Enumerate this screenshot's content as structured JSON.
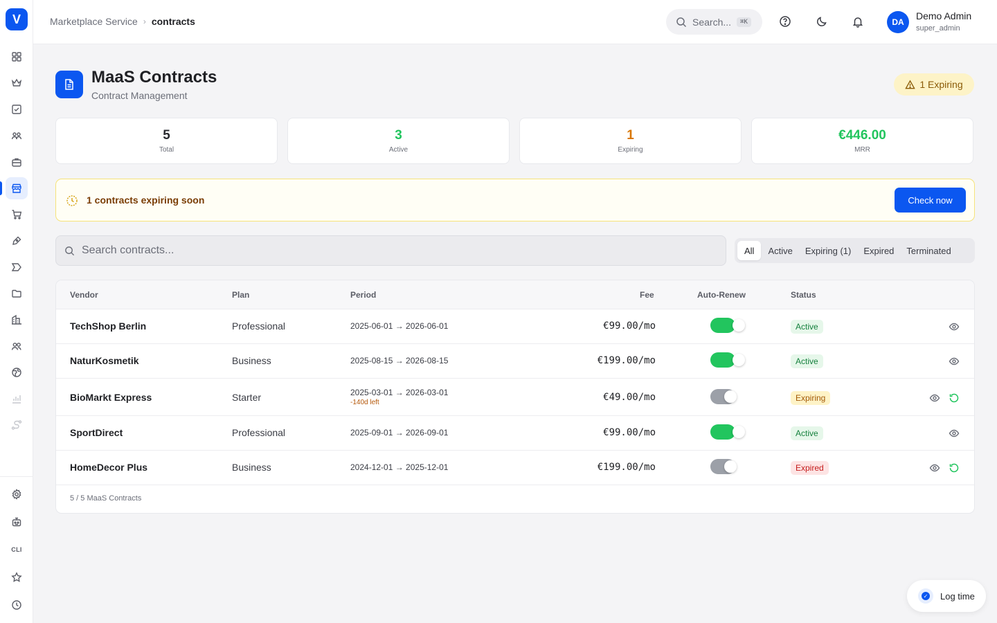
{
  "app": {
    "logo_letter": "V"
  },
  "breadcrumb": {
    "parent": "Marketplace Service",
    "separator": "›",
    "current": "contracts"
  },
  "topbar": {
    "search_placeholder": "Search...",
    "shortcut": "⌘K",
    "user": {
      "initials": "DA",
      "name": "Demo Admin",
      "role": "super_admin"
    }
  },
  "header": {
    "title": "MaaS Contracts",
    "subtitle": "Contract Management",
    "expiring_badge": "1 Expiring"
  },
  "stats": [
    {
      "value": "5",
      "label": "Total",
      "color": "#2a2b30"
    },
    {
      "value": "3",
      "label": "Active",
      "color": "#22c55e"
    },
    {
      "value": "1",
      "label": "Expiring",
      "color": "#d97706"
    },
    {
      "value": "€446.00",
      "label": "MRR",
      "color": "#22c55e"
    }
  ],
  "alert": {
    "text": "1 contracts expiring soon",
    "button": "Check now"
  },
  "search": {
    "placeholder": "Search contracts..."
  },
  "filters": [
    "All",
    "Active",
    "Expiring (1)",
    "Expired",
    "Terminated"
  ],
  "table": {
    "headers": {
      "vendor": "Vendor",
      "plan": "Plan",
      "period": "Period",
      "fee": "Fee",
      "auto_renew": "Auto-Renew",
      "status": "Status"
    },
    "rows": [
      {
        "vendor": "TechShop Berlin",
        "plan": "Professional",
        "period": "2025-06-01 → 2026-06-01",
        "days_left": "",
        "fee": "€99.00/mo",
        "auto_renew": true,
        "status": "Active",
        "renewable": false
      },
      {
        "vendor": "NaturKosmetik",
        "plan": "Business",
        "period": "2025-08-15 → 2026-08-15",
        "days_left": "",
        "fee": "€199.00/mo",
        "auto_renew": true,
        "status": "Active",
        "renewable": false
      },
      {
        "vendor": "BioMarkt Express",
        "plan": "Starter",
        "period": "2025-03-01 → 2026-03-01",
        "days_left": "-140d left",
        "fee": "€49.00/mo",
        "auto_renew": false,
        "status": "Expiring",
        "renewable": true
      },
      {
        "vendor": "SportDirect",
        "plan": "Professional",
        "period": "2025-09-01 → 2026-09-01",
        "days_left": "",
        "fee": "€99.00/mo",
        "auto_renew": true,
        "status": "Active",
        "renewable": false
      },
      {
        "vendor": "HomeDecor Plus",
        "plan": "Business",
        "period": "2024-12-01 → 2025-12-01",
        "days_left": "",
        "fee": "€199.00/mo",
        "auto_renew": false,
        "status": "Expired",
        "renewable": true
      }
    ],
    "footer": "5 / 5 MaaS Contracts"
  },
  "log_time": {
    "label": "Log time"
  },
  "sidebar": {
    "items": [
      "dashboard-icon",
      "crown-icon",
      "checklist-icon",
      "users-icon",
      "briefcase-icon",
      "store-icon",
      "cart-icon",
      "pen-icon",
      "megaphone-icon",
      "folder-icon",
      "building-icon",
      "team-icon",
      "globe-icon",
      "chart-icon",
      "route-icon"
    ],
    "bottom": [
      "settings-icon",
      "robot-icon",
      "cli-label",
      "star-icon",
      "clock-icon"
    ],
    "cli_label": "CLI"
  },
  "colors": {
    "primary": "#0b57f0",
    "success": "#22c55e",
    "warning": "#d97706",
    "danger": "#c41b1b"
  }
}
